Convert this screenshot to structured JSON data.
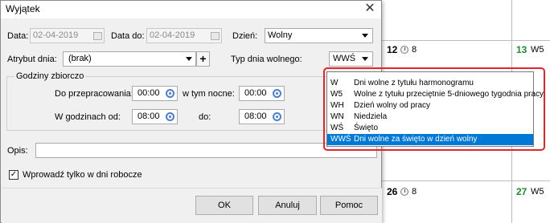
{
  "dialog": {
    "title": "Wyjątek",
    "close_glyph": "✕",
    "date_from_label": "Data:",
    "date_from_value": "02-04-2019",
    "date_to_label": "Data do:",
    "date_to_value": "02-04-2019",
    "day_label": "Dzień:",
    "day_value": "Wolny",
    "attribute_label": "Atrybut dnia:",
    "attribute_value": "(brak)",
    "add_glyph": "+",
    "free_day_type_label": "Typ dnia wolnego:",
    "free_day_type_value": "WWŚ",
    "hours_group_label": "Godziny zbiorczo",
    "to_work_label": "Do przepracowania:",
    "to_work_value": "00:00",
    "night_label": "w tym nocne:",
    "night_value": "00:00",
    "hours_from_label": "W godzinach od:",
    "hours_from_value": "08:00",
    "hours_to_label": "do:",
    "hours_to_value": "08:00",
    "description_label": "Opis:",
    "description_value": "",
    "workdays_only_label": "Wprowadź tylko w dni robocze",
    "workdays_only_checked": true,
    "ok_label": "OK",
    "cancel_label": "Anuluj",
    "help_label": "Pomoc"
  },
  "dropdown": {
    "options": [
      {
        "code": "W",
        "desc": "Dni wolne z tytułu harmonogramu",
        "selected": false
      },
      {
        "code": "W5",
        "desc": "Wolne z tytułu przeciętnie 5-dniowego tygodnia pracy",
        "selected": false
      },
      {
        "code": "WH",
        "desc": "Dzień wolny od pracy",
        "selected": false
      },
      {
        "code": "WN",
        "desc": "Niedziela",
        "selected": false
      },
      {
        "code": "WŚ",
        "desc": "Święto",
        "selected": false
      },
      {
        "code": "WWŚ",
        "desc": "Dni wolne za święto w dzień wolny",
        "selected": true
      }
    ]
  },
  "calendar": {
    "cells": [
      {
        "day": "12",
        "count": "8",
        "color": "#000000"
      },
      {
        "day": "13",
        "count": "W5",
        "color": "#1e8a2e"
      },
      {
        "day": "26",
        "count": "8",
        "color": "#000000"
      },
      {
        "day": "27",
        "count": "W5",
        "color": "#1e8a2e"
      }
    ]
  }
}
